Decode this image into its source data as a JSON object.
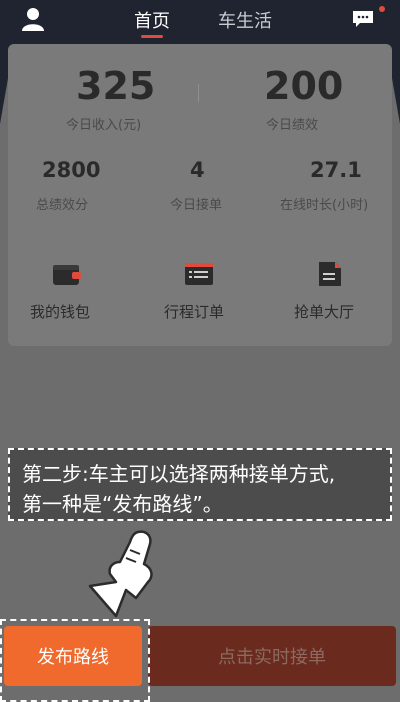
{
  "header": {
    "tabs": [
      {
        "label": "首页",
        "active": true
      },
      {
        "label": "车生活",
        "active": false
      }
    ],
    "accent_color": "#e24a3b"
  },
  "stats": {
    "income_value": "325",
    "income_label": "今日收入(元)",
    "performance_value": "200",
    "performance_label": "今日绩效",
    "total_perf_value": "2800",
    "total_perf_label": "总绩效分",
    "orders_value": "4",
    "orders_label": "今日接单",
    "online_value": "27.1",
    "online_label": "在线时长(小时)"
  },
  "entries": [
    {
      "label": "我的钱包",
      "icon": "wallet-icon"
    },
    {
      "label": "行程订单",
      "icon": "order-list-icon"
    },
    {
      "label": "抢单大厅",
      "icon": "document-icon"
    }
  ],
  "tutorial": {
    "line1": "第二步:车主可以选择两种接单方式,",
    "line2": "第一种是“发布路线”。"
  },
  "buttons": {
    "publish_route": "发布路线",
    "realtime_order": "点击实时接单"
  }
}
